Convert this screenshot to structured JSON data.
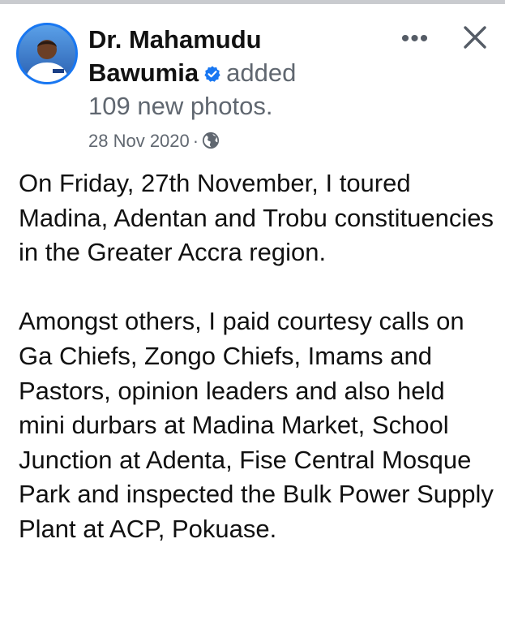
{
  "post": {
    "author": "Dr. Mahamudu Bawumia",
    "author_line1": "Dr. Mahamudu",
    "author_line2": "Bawumia",
    "action_word": "added",
    "action_object": "109 new photos.",
    "date": "28 Nov 2020",
    "separator": "·",
    "privacy_icon": "globe-icon",
    "verified_icon": "verified-badge-icon",
    "more_icon": "more-options-icon",
    "more_label": "•••",
    "close_icon": "close-icon",
    "paragraphs": [
      "On Friday, 27th November, I toured Madina, Adentan and Trobu constituencies in the Greater Accra region.",
      "Amongst others, I paid courtesy calls on Ga Chiefs, Zongo Chiefs, Imams and Pastors, opinion leaders and also held mini durbars at Madina Market, School Junction at Adenta, Fise Central Mosque Park and inspected the Bulk Power Supply Plant at ACP,  Pokuase."
    ]
  },
  "colors": {
    "accent": "#1877f2",
    "secondary_text": "#606770",
    "primary_text": "#111111"
  }
}
